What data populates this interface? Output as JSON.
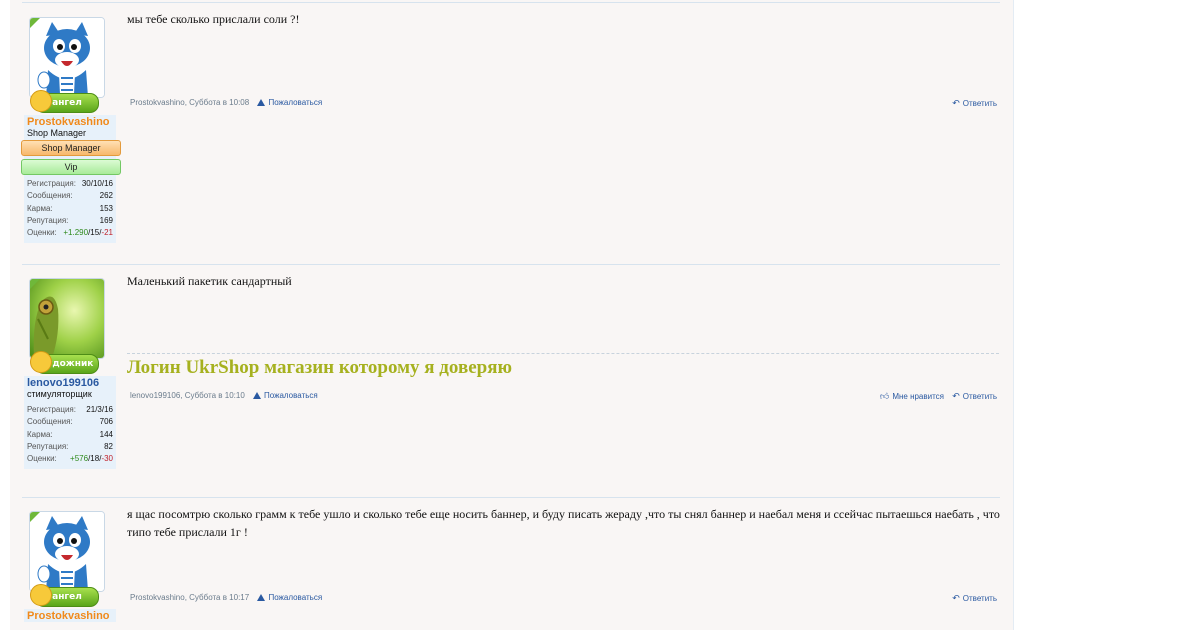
{
  "posts": [
    {
      "username": "Prostokvashino",
      "username_color": "#f08a1c",
      "user_title": "Shop Manager",
      "rank": "ангел",
      "banners": [
        "Shop Manager",
        "Vip"
      ],
      "stats": {
        "reg_label": "Регистрация:",
        "reg": "30/10/16",
        "msgs_label": "Сообщения:",
        "msgs": "262",
        "karma_label": "Карма:",
        "karma": "153",
        "rep_label": "Репутация:",
        "rep": "169",
        "ratings_label": "Оценки:",
        "r_pos": "+1.290",
        "r_neu": "15",
        "r_neg": "-21"
      },
      "message": "мы тебе сколько прислали соли ?!",
      "meta_author": "Prostokvashino",
      "meta_time": "Суббота в 10:08",
      "report": "Пожаловаться",
      "reply": "Ответить"
    },
    {
      "username": "lenovo199106",
      "username_color": "#2a59a1",
      "user_title": "стимуляторщик",
      "rank": "художник",
      "stats": {
        "reg_label": "Регистрация:",
        "reg": "21/3/16",
        "msgs_label": "Сообщения:",
        "msgs": "706",
        "karma_label": "Карма:",
        "karma": "144",
        "rep_label": "Репутация:",
        "rep": "82",
        "ratings_label": "Оценки:",
        "r_pos": "+576",
        "r_neu": "18",
        "r_neg": "-30"
      },
      "message": "Маленький пакетик сандартный",
      "signature": "Логин UkrShop магазин которому я доверяю",
      "meta_author": "lenovo199106",
      "meta_time": "Суббота в 10:10",
      "report": "Пожаловаться",
      "like": "Мне нравится",
      "reply": "Ответить"
    },
    {
      "username": "Prostokvashino",
      "username_color": "#f08a1c",
      "rank": "ангел",
      "message": "я щас посомтрю сколько грамм к тебе ушло и сколько тебе еще носить баннер, и буду писать жераду ,что ты снял баннер и наебал меня и ссейчас пытаешься наебать , что типо тебе прислали 1г !",
      "meta_author": "Prostokvashino",
      "meta_time": "Суббота в 10:17",
      "report": "Пожаловаться",
      "reply": "Ответить"
    }
  ]
}
